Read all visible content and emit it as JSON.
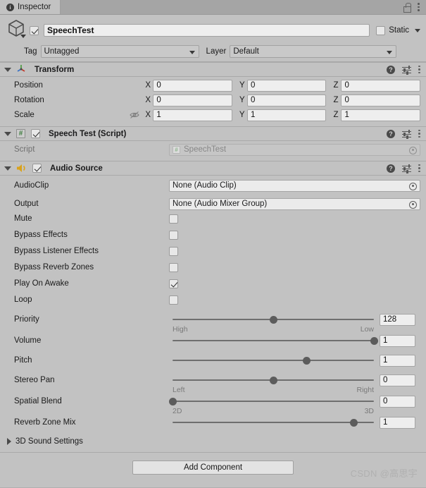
{
  "window": {
    "tab_label": "Inspector",
    "tab_icon": "info-icon",
    "lock_icon": "lock-icon",
    "menu_icon": "kebab-menu-icon"
  },
  "gameobject": {
    "icon": "cube-icon",
    "enabled": true,
    "name": "SpeechTest",
    "static_label": "Static",
    "static_checked": false,
    "tag_label": "Tag",
    "tag_value": "Untagged",
    "layer_label": "Layer",
    "layer_value": "Default"
  },
  "components": [
    {
      "id": "transform",
      "title": "Transform",
      "icon": "transform-axis-icon",
      "expanded": true,
      "has_enable_checkbox": false,
      "rows": [
        {
          "label": "Position",
          "axes": [
            {
              "axis": "X",
              "value": "0"
            },
            {
              "axis": "Y",
              "value": "0"
            },
            {
              "axis": "Z",
              "value": "0"
            }
          ]
        },
        {
          "label": "Rotation",
          "axes": [
            {
              "axis": "X",
              "value": "0"
            },
            {
              "axis": "Y",
              "value": "0"
            },
            {
              "axis": "Z",
              "value": "0"
            }
          ]
        },
        {
          "label": "Scale",
          "hidden_toggle": true,
          "axes": [
            {
              "axis": "X",
              "value": "1"
            },
            {
              "axis": "Y",
              "value": "1"
            },
            {
              "axis": "Z",
              "value": "1"
            }
          ]
        }
      ]
    },
    {
      "id": "speech-test-script",
      "title": "Speech Test (Script)",
      "icon": "script-hash-icon",
      "expanded": true,
      "enabled": true,
      "script_row_label": "Script",
      "script_row_value": "SpeechTest"
    },
    {
      "id": "audio-source",
      "title": "Audio Source",
      "icon": "audio-speaker-icon",
      "expanded": true,
      "enabled": true
    }
  ],
  "audio_source": {
    "audioclip_label": "AudioClip",
    "audioclip_value": "None (Audio Clip)",
    "output_label": "Output",
    "output_value": "None (Audio Mixer Group)",
    "checkboxes": [
      {
        "label": "Mute",
        "checked": false
      },
      {
        "label": "Bypass Effects",
        "checked": false
      },
      {
        "label": "Bypass Listener Effects",
        "checked": false
      },
      {
        "label": "Bypass Reverb Zones",
        "checked": false
      },
      {
        "label": "Play On Awake",
        "checked": true
      },
      {
        "label": "Loop",
        "checked": false
      }
    ],
    "sliders": [
      {
        "label": "Priority",
        "value": "128",
        "pct": 50,
        "left_cap": "High",
        "right_cap": "Low"
      },
      {
        "label": "Volume",
        "value": "1",
        "pct": 100,
        "left_cap": "",
        "right_cap": ""
      },
      {
        "label": "Pitch",
        "value": "1",
        "pct": 66.7,
        "left_cap": "",
        "right_cap": ""
      },
      {
        "label": "Stereo Pan",
        "value": "0",
        "pct": 50,
        "left_cap": "Left",
        "right_cap": "Right"
      },
      {
        "label": "Spatial Blend",
        "value": "0",
        "pct": 0,
        "left_cap": "2D",
        "right_cap": "3D"
      },
      {
        "label": "Reverb Zone Mix",
        "value": "1",
        "pct": 90,
        "left_cap": "",
        "right_cap": ""
      }
    ],
    "sound3d_label": "3D Sound Settings",
    "sound3d_expanded": false
  },
  "footer": {
    "add_component_label": "Add Component"
  },
  "watermark": {
    "text": "CSDN @高思宇"
  },
  "colors": {
    "panel_bg": "#c2c2c2",
    "tabbar_bg": "#a5a5a5",
    "field_bg": "#eeeeee",
    "slider_track": "#6e6e6e",
    "slider_thumb": "#5c5c5c",
    "script_green": "#3f7d3f",
    "audio_yellow": "#d9a21b"
  }
}
